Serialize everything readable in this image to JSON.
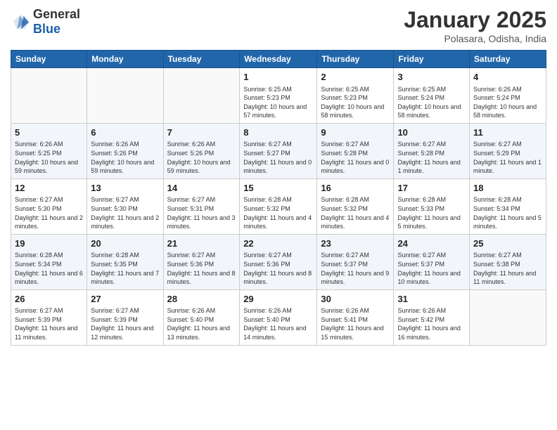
{
  "logo": {
    "text_general": "General",
    "text_blue": "Blue"
  },
  "header": {
    "month": "January 2025",
    "location": "Polasara, Odisha, India"
  },
  "days_of_week": [
    "Sunday",
    "Monday",
    "Tuesday",
    "Wednesday",
    "Thursday",
    "Friday",
    "Saturday"
  ],
  "weeks": [
    [
      {
        "day": "",
        "info": ""
      },
      {
        "day": "",
        "info": ""
      },
      {
        "day": "",
        "info": ""
      },
      {
        "day": "1",
        "info": "Sunrise: 6:25 AM\nSunset: 5:23 PM\nDaylight: 10 hours and 57 minutes."
      },
      {
        "day": "2",
        "info": "Sunrise: 6:25 AM\nSunset: 5:23 PM\nDaylight: 10 hours and 58 minutes."
      },
      {
        "day": "3",
        "info": "Sunrise: 6:25 AM\nSunset: 5:24 PM\nDaylight: 10 hours and 58 minutes."
      },
      {
        "day": "4",
        "info": "Sunrise: 6:26 AM\nSunset: 5:24 PM\nDaylight: 10 hours and 58 minutes."
      }
    ],
    [
      {
        "day": "5",
        "info": "Sunrise: 6:26 AM\nSunset: 5:25 PM\nDaylight: 10 hours and 59 minutes."
      },
      {
        "day": "6",
        "info": "Sunrise: 6:26 AM\nSunset: 5:26 PM\nDaylight: 10 hours and 59 minutes."
      },
      {
        "day": "7",
        "info": "Sunrise: 6:26 AM\nSunset: 5:26 PM\nDaylight: 10 hours and 59 minutes."
      },
      {
        "day": "8",
        "info": "Sunrise: 6:27 AM\nSunset: 5:27 PM\nDaylight: 11 hours and 0 minutes."
      },
      {
        "day": "9",
        "info": "Sunrise: 6:27 AM\nSunset: 5:28 PM\nDaylight: 11 hours and 0 minutes."
      },
      {
        "day": "10",
        "info": "Sunrise: 6:27 AM\nSunset: 5:28 PM\nDaylight: 11 hours and 1 minute."
      },
      {
        "day": "11",
        "info": "Sunrise: 6:27 AM\nSunset: 5:29 PM\nDaylight: 11 hours and 1 minute."
      }
    ],
    [
      {
        "day": "12",
        "info": "Sunrise: 6:27 AM\nSunset: 5:30 PM\nDaylight: 11 hours and 2 minutes."
      },
      {
        "day": "13",
        "info": "Sunrise: 6:27 AM\nSunset: 5:30 PM\nDaylight: 11 hours and 2 minutes."
      },
      {
        "day": "14",
        "info": "Sunrise: 6:27 AM\nSunset: 5:31 PM\nDaylight: 11 hours and 3 minutes."
      },
      {
        "day": "15",
        "info": "Sunrise: 6:28 AM\nSunset: 5:32 PM\nDaylight: 11 hours and 4 minutes."
      },
      {
        "day": "16",
        "info": "Sunrise: 6:28 AM\nSunset: 5:32 PM\nDaylight: 11 hours and 4 minutes."
      },
      {
        "day": "17",
        "info": "Sunrise: 6:28 AM\nSunset: 5:33 PM\nDaylight: 11 hours and 5 minutes."
      },
      {
        "day": "18",
        "info": "Sunrise: 6:28 AM\nSunset: 5:34 PM\nDaylight: 11 hours and 5 minutes."
      }
    ],
    [
      {
        "day": "19",
        "info": "Sunrise: 6:28 AM\nSunset: 5:34 PM\nDaylight: 11 hours and 6 minutes."
      },
      {
        "day": "20",
        "info": "Sunrise: 6:28 AM\nSunset: 5:35 PM\nDaylight: 11 hours and 7 minutes."
      },
      {
        "day": "21",
        "info": "Sunrise: 6:27 AM\nSunset: 5:36 PM\nDaylight: 11 hours and 8 minutes."
      },
      {
        "day": "22",
        "info": "Sunrise: 6:27 AM\nSunset: 5:36 PM\nDaylight: 11 hours and 8 minutes."
      },
      {
        "day": "23",
        "info": "Sunrise: 6:27 AM\nSunset: 5:37 PM\nDaylight: 11 hours and 9 minutes."
      },
      {
        "day": "24",
        "info": "Sunrise: 6:27 AM\nSunset: 5:37 PM\nDaylight: 11 hours and 10 minutes."
      },
      {
        "day": "25",
        "info": "Sunrise: 6:27 AM\nSunset: 5:38 PM\nDaylight: 11 hours and 11 minutes."
      }
    ],
    [
      {
        "day": "26",
        "info": "Sunrise: 6:27 AM\nSunset: 5:39 PM\nDaylight: 11 hours and 11 minutes."
      },
      {
        "day": "27",
        "info": "Sunrise: 6:27 AM\nSunset: 5:39 PM\nDaylight: 11 hours and 12 minutes."
      },
      {
        "day": "28",
        "info": "Sunrise: 6:26 AM\nSunset: 5:40 PM\nDaylight: 11 hours and 13 minutes."
      },
      {
        "day": "29",
        "info": "Sunrise: 6:26 AM\nSunset: 5:40 PM\nDaylight: 11 hours and 14 minutes."
      },
      {
        "day": "30",
        "info": "Sunrise: 6:26 AM\nSunset: 5:41 PM\nDaylight: 11 hours and 15 minutes."
      },
      {
        "day": "31",
        "info": "Sunrise: 6:26 AM\nSunset: 5:42 PM\nDaylight: 11 hours and 16 minutes."
      },
      {
        "day": "",
        "info": ""
      }
    ]
  ]
}
